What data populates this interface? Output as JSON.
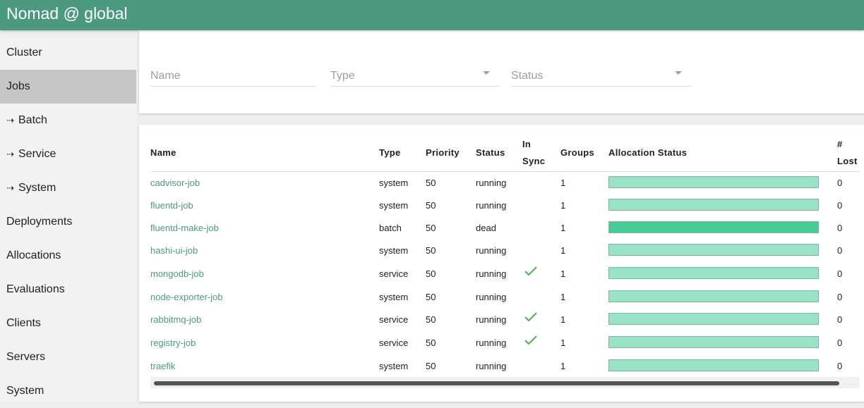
{
  "app": {
    "title": "Nomad @ global"
  },
  "sidebar": {
    "items": [
      {
        "label": "Cluster",
        "arrow": ""
      },
      {
        "label": "Jobs",
        "arrow": "",
        "active": true
      },
      {
        "label": "Batch",
        "arrow": "⇢"
      },
      {
        "label": "Service",
        "arrow": "⇢"
      },
      {
        "label": "System",
        "arrow": "⇢"
      },
      {
        "label": "Deployments",
        "arrow": ""
      },
      {
        "label": "Allocations",
        "arrow": ""
      },
      {
        "label": "Evaluations",
        "arrow": ""
      },
      {
        "label": "Clients",
        "arrow": ""
      },
      {
        "label": "Servers",
        "arrow": ""
      },
      {
        "label": "System",
        "arrow": ""
      }
    ]
  },
  "filters": {
    "name_placeholder": "Name",
    "type_label": "Type",
    "status_label": "Status"
  },
  "table": {
    "headers": {
      "name": "Name",
      "type": "Type",
      "priority": "Priority",
      "status": "Status",
      "insync_line1": "In",
      "insync_line2": "Sync",
      "groups": "Groups",
      "alloc": "Allocation Status",
      "lost_line1": "#",
      "lost_line2": "Lost"
    },
    "rows": [
      {
        "name": "cadvisor-job",
        "type": "system",
        "priority": "50",
        "status": "running",
        "insync": false,
        "groups": "1",
        "alloc_color": "#98e2c6",
        "lost": "0"
      },
      {
        "name": "fluentd-job",
        "type": "system",
        "priority": "50",
        "status": "running",
        "insync": false,
        "groups": "1",
        "alloc_color": "#98e2c6",
        "lost": "0"
      },
      {
        "name": "fluentd-make-job",
        "type": "batch",
        "priority": "50",
        "status": "dead",
        "insync": false,
        "groups": "1",
        "alloc_color": "#45cc97",
        "lost": "0"
      },
      {
        "name": "hashi-ui-job",
        "type": "system",
        "priority": "50",
        "status": "running",
        "insync": false,
        "groups": "1",
        "alloc_color": "#98e2c6",
        "lost": "0"
      },
      {
        "name": "mongodb-job",
        "type": "service",
        "priority": "50",
        "status": "running",
        "insync": true,
        "groups": "1",
        "alloc_color": "#98e2c6",
        "lost": "0"
      },
      {
        "name": "node-exporter-job",
        "type": "system",
        "priority": "50",
        "status": "running",
        "insync": false,
        "groups": "1",
        "alloc_color": "#98e2c6",
        "lost": "0"
      },
      {
        "name": "rabbitmq-job",
        "type": "service",
        "priority": "50",
        "status": "running",
        "insync": true,
        "groups": "1",
        "alloc_color": "#98e2c6",
        "lost": "0"
      },
      {
        "name": "registry-job",
        "type": "service",
        "priority": "50",
        "status": "running",
        "insync": true,
        "groups": "1",
        "alloc_color": "#98e2c6",
        "lost": "0"
      },
      {
        "name": "traefik",
        "type": "system",
        "priority": "50",
        "status": "running",
        "insync": false,
        "groups": "1",
        "alloc_color": "#98e2c6",
        "lost": "0"
      }
    ]
  },
  "colors": {
    "brand": "#4c9a7e",
    "check": "#4caf50"
  }
}
